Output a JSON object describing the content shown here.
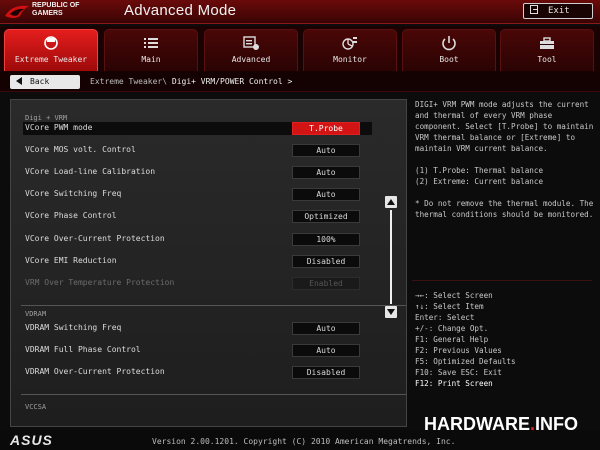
{
  "header": {
    "brand_line1": "REPUBLIC OF",
    "brand_line2": "GAMERS",
    "title": "Advanced Mode",
    "exit_label": "Exit"
  },
  "tabs": [
    {
      "label": "Extreme Tweaker",
      "icon": "gauge-icon",
      "active": true
    },
    {
      "label": "Main",
      "icon": "list-icon",
      "active": false
    },
    {
      "label": "Advanced",
      "icon": "advanced-icon",
      "active": false
    },
    {
      "label": "Monitor",
      "icon": "fan-monitor-icon",
      "active": false
    },
    {
      "label": "Boot",
      "icon": "power-icon",
      "active": false
    },
    {
      "label": "Tool",
      "icon": "toolbox-icon",
      "active": false
    }
  ],
  "nav": {
    "back_label": "Back",
    "breadcrumb_parent": "Extreme Tweaker\\",
    "breadcrumb_current": "Digi+ VRM/POWER Control >"
  },
  "sections": {
    "digi": "Digi + VRM",
    "vdram": "VDRAM",
    "vccsa": "VCCSA"
  },
  "settings": [
    {
      "label": "VCore PWM mode",
      "value": "T.Probe"
    },
    {
      "label": "VCore MOS volt. Control",
      "value": "Auto"
    },
    {
      "label": "VCore Load-line Calibration",
      "value": "Auto"
    },
    {
      "label": "VCore Switching Freq",
      "value": "Auto"
    },
    {
      "label": "VCore Phase Control",
      "value": "Optimized"
    },
    {
      "label": "VCore Over-Current Protection",
      "value": "100%"
    },
    {
      "label": "VCore EMI Reduction",
      "value": "Disabled"
    },
    {
      "label": "VRM Over Temperature Protection",
      "value": "Enabled"
    },
    {
      "label": "VDRAM Switching Freq",
      "value": "Auto"
    },
    {
      "label": "VDRAM Full Phase Control",
      "value": "Auto"
    },
    {
      "label": "VDRAM Over-Current Protection",
      "value": "Disabled"
    }
  ],
  "help": {
    "p1": "DIGI+ VRM PWM mode adjusts the current and thermal of every VRM phase component. Select [T.Probe] to maintain VRM thermal balance or [Extreme] to maintain VRM current balance.",
    "p2a": "(1) T.Probe: Thermal balance",
    "p2b": "(2) Extreme: Current balance",
    "p3": "* Do not remove the thermal module. The thermal conditions should be monitored."
  },
  "keys": [
    "→←: Select Screen",
    "↑↓: Select Item",
    "Enter: Select",
    "+/-: Change Opt.",
    "F1: General Help",
    "F2: Previous Values",
    "F5: Optimized Defaults",
    "F10: Save  ESC: Exit",
    "F12: Print Screen"
  ],
  "footer": {
    "logo": "ASUS",
    "version": "Version 2.00.1201. Copyright (C) 2010 American Megatrends, Inc.",
    "watermark_a": "HARDWARE",
    "watermark_dot": ".",
    "watermark_b": "INFO"
  },
  "colors": {
    "accent": "#d31414",
    "header": "#5a0808"
  }
}
